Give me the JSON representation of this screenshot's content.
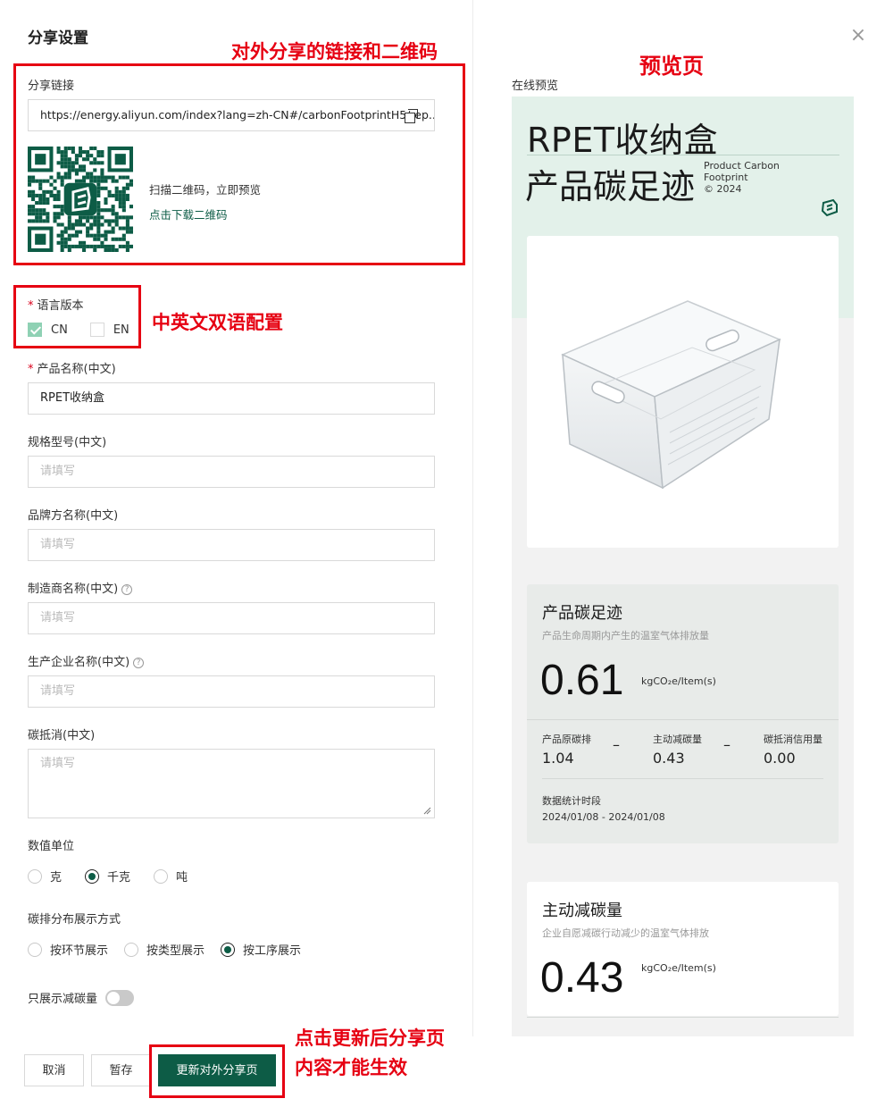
{
  "header": {
    "title": "分享设置",
    "close_icon": "close-icon"
  },
  "share": {
    "link_label": "分享链接",
    "link_value": "https://energy.aliyun.com/index?lang=zh-CN#/carbonFootprintH5/rep...",
    "scan_text": "扫描二维码，立即预览",
    "download_text": "点击下载二维码"
  },
  "language": {
    "label": "语言版本",
    "options": [
      "CN",
      "EN"
    ],
    "cn_checked": true,
    "en_checked": false
  },
  "fields": {
    "product_name_label": "产品名称(中文)",
    "product_name_value": "RPET收纳盒",
    "spec_label": "规格型号(中文)",
    "brand_label": "品牌方名称(中文)",
    "manufacturer_label": "制造商名称(中文)",
    "producer_label": "生产企业名称(中文)",
    "offset_label": "碳抵消(中文)",
    "placeholder": "请填写"
  },
  "unit": {
    "label": "数值单位",
    "options": [
      "克",
      "千克",
      "吨"
    ],
    "selected": "千克"
  },
  "distribution": {
    "label": "碳排分布展示方式",
    "options": [
      "按环节展示",
      "按类型展示",
      "按工序展示"
    ],
    "selected": "按工序展示"
  },
  "only_reduction": {
    "label": "只展示减碳量",
    "enabled": false
  },
  "buttons": {
    "cancel": "取消",
    "save": "暂存",
    "update": "更新对外分享页"
  },
  "annotations": {
    "share_link_qr": "对外分享的链接和二维码",
    "bilingual": "中英文双语配置",
    "preview_page": "预览页",
    "update_note_line1": "点击更新后分享页",
    "update_note_line2": "内容才能生效"
  },
  "preview": {
    "label": "在线预览",
    "title_line1": "RPET收纳盒",
    "title_line2": "产品碳足迹",
    "sub_line1": "Product Carbon",
    "sub_line2": "Footprint",
    "sub_line3": "© 2024",
    "footprint_card": {
      "title": "产品碳足迹",
      "desc": "产品生命周期内产生的温室气体排放量",
      "value": "0.61",
      "unit": "kgCO₂e/Item(s)",
      "metrics": [
        {
          "label": "产品原碳排",
          "value": "1.04"
        },
        {
          "label": "主动减碳量",
          "value": "0.43"
        },
        {
          "label": "碳抵消信用量",
          "value": "0.00"
        }
      ],
      "period_label": "数据统计时段",
      "period_value": "2024/01/08 - 2024/01/08"
    },
    "reduction_card": {
      "title": "主动减碳量",
      "desc": "企业自愿减碳行动减少的温室气体排放",
      "value": "0.43",
      "unit": "kgCO₂e/Item(s)"
    }
  },
  "colors": {
    "brand_green": "#0d5c46",
    "annotation_red": "#e60012",
    "preview_mint": "#e3f1ea"
  }
}
